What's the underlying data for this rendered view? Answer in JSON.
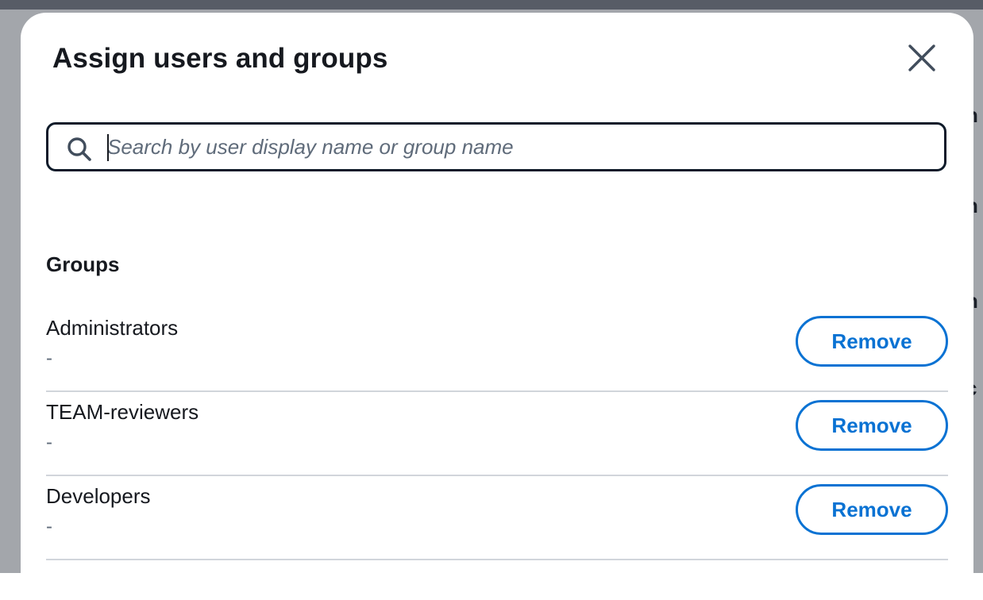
{
  "modal": {
    "title": "Assign users and groups",
    "close_icon": "close-icon",
    "search": {
      "icon": "search-icon",
      "placeholder": "Search by user display name or group name",
      "value": ""
    },
    "groups_section": {
      "heading": "Groups",
      "items": [
        {
          "name": "Administrators",
          "description": "-",
          "action_label": "Remove"
        },
        {
          "name": "TEAM-reviewers",
          "description": "-",
          "action_label": "Remove"
        },
        {
          "name": "Developers",
          "description": "-",
          "action_label": "Remove"
        }
      ]
    }
  },
  "colors": {
    "primary_text": "#16191f",
    "secondary_text": "#5f6b7a",
    "accent": "#0972d3",
    "search_border": "#0f1b2a",
    "divider": "#d1d5db",
    "backdrop": "#7d8089"
  }
}
